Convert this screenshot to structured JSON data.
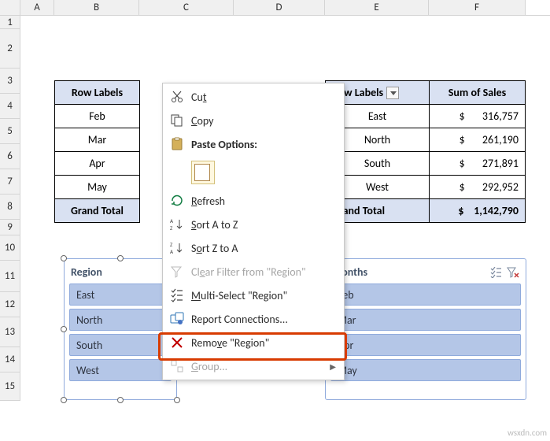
{
  "columns": [
    "A",
    "B",
    "C",
    "D",
    "E",
    "F"
  ],
  "rows": [
    "1",
    "2",
    "3",
    "4",
    "5",
    "6",
    "7",
    "8",
    "9",
    "10",
    "11",
    "12",
    "13",
    "14",
    "15"
  ],
  "pivot_left": {
    "header": "Row Labels",
    "items": [
      "Feb",
      "Mar",
      "Apr",
      "May"
    ],
    "grand": "Grand Total"
  },
  "pivot_right": {
    "header1": "Row Labels",
    "header2": "Sum of Sales",
    "rows": [
      {
        "label": "East",
        "value": "$       316,757"
      },
      {
        "label": "North",
        "value": "$       261,190"
      },
      {
        "label": "South",
        "value": "$       271,891"
      },
      {
        "label": "West",
        "value": "$       292,952"
      }
    ],
    "grand_label": "Grand Total",
    "grand_value": "$    1,142,790"
  },
  "slicer_region": {
    "title": "Region",
    "items": [
      "East",
      "North",
      "South",
      "West"
    ]
  },
  "slicer_months": {
    "title": "Months",
    "items": [
      "Feb",
      "Mar",
      "Apr",
      "May"
    ]
  },
  "ctx": {
    "cut": "Cut",
    "copy": "Copy",
    "paste": "Paste Options:",
    "refresh": "Refresh",
    "sort_az": "Sort A to Z",
    "sort_za": "Sort Z to A",
    "clear": "Clear Filter from \"Region\"",
    "multi": "Multi-Select \"Region\"",
    "report": "Report Connections...",
    "remove": "Remove \"Region\"",
    "group": "Group..."
  },
  "watermark": "wsxdn.com"
}
